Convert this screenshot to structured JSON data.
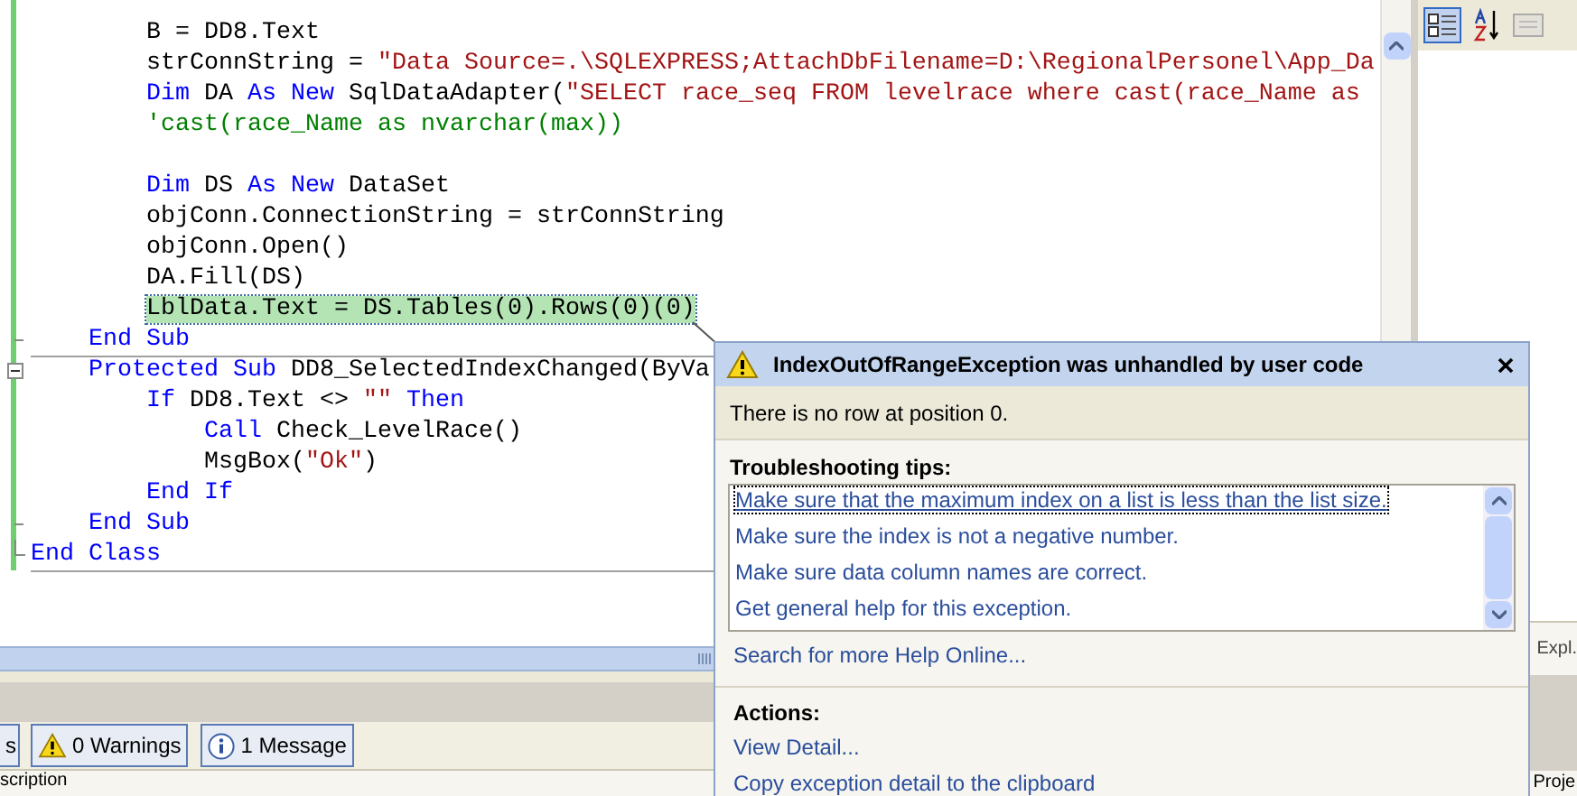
{
  "code_lines": [
    {
      "segments": [
        {
          "kind": "plain",
          "text": "        B = DD8.Text"
        }
      ]
    },
    {
      "segments": [
        {
          "kind": "plain",
          "text": "        strConnString = "
        },
        {
          "kind": "string",
          "text": "\"Data Source=.\\SQLEXPRESS;AttachDbFilename=D:\\RegionalPersonel\\App_Da"
        }
      ]
    },
    {
      "segments": [
        {
          "kind": "keyword",
          "text": "        Dim"
        },
        {
          "kind": "plain",
          "text": " DA "
        },
        {
          "kind": "keyword",
          "text": "As"
        },
        {
          "kind": "keyword",
          "text": " New"
        },
        {
          "kind": "plain",
          "text": " SqlDataAdapter("
        },
        {
          "kind": "string",
          "text": "\"SELECT race_seq FROM levelrace where cast(race_Name as"
        }
      ]
    },
    {
      "segments": [
        {
          "kind": "comment",
          "text": "        'cast(race_Name as nvarchar(max))"
        }
      ]
    },
    {
      "blank_line_before": true,
      "segments": [
        {
          "kind": "keyword",
          "text": "        Dim"
        },
        {
          "kind": "plain",
          "text": " DS "
        },
        {
          "kind": "keyword",
          "text": "As"
        },
        {
          "kind": "keyword",
          "text": " New"
        },
        {
          "kind": "plain",
          "text": " DataSet"
        }
      ]
    },
    {
      "segments": [
        {
          "kind": "plain",
          "text": "        objConn.ConnectionString = strConnString"
        }
      ]
    },
    {
      "segments": [
        {
          "kind": "plain",
          "text": "        objConn.Open()"
        }
      ]
    },
    {
      "segments": [
        {
          "kind": "plain",
          "text": "        DA.Fill(DS)"
        }
      ]
    },
    {
      "highlighted": true,
      "segments": [
        {
          "kind": "plain",
          "text": "        LblData.Text = DS.Tables(0).Rows(0)(0)"
        }
      ]
    },
    {
      "separator_below": true,
      "block_end": true,
      "segments": [
        {
          "kind": "keyword",
          "text": "    End Sub"
        }
      ]
    },
    {
      "expanded": true,
      "segments": [
        {
          "kind": "keyword",
          "text": "    Protected Sub"
        },
        {
          "kind": "plain",
          "text": " DD8_SelectedIndexChanged(ByVa"
        }
      ]
    },
    {
      "segments": [
        {
          "kind": "keyword",
          "text": "        If"
        },
        {
          "kind": "plain",
          "text": " DD8.Text <> "
        },
        {
          "kind": "string",
          "text": "\"\""
        },
        {
          "kind": "keyword",
          "text": " Then"
        }
      ]
    },
    {
      "segments": [
        {
          "kind": "keyword",
          "text": "            Call"
        },
        {
          "kind": "plain",
          "text": " Check_LevelRace()"
        }
      ]
    },
    {
      "segments": [
        {
          "kind": "plain",
          "text": "            MsgBox("
        },
        {
          "kind": "string",
          "text": "\"Ok\""
        },
        {
          "kind": "plain",
          "text": ")"
        }
      ]
    },
    {
      "segments": [
        {
          "kind": "keyword",
          "text": "        End If"
        }
      ]
    },
    {
      "block_end": true,
      "segments": [
        {
          "kind": "keyword",
          "text": "    End Sub"
        }
      ]
    },
    {
      "separator_below": true,
      "block_end": true,
      "segments": [
        {
          "kind": "keyword",
          "text": "End Class"
        }
      ]
    }
  ],
  "exception_helper": {
    "title": "IndexOutOfRangeException was unhandled by user code",
    "message": "There is no row at position 0.",
    "tips_heading": "Troubleshooting tips:",
    "tips": [
      {
        "text": "Make sure that the maximum index on a list is less than the list size.",
        "selected": true
      },
      {
        "text": "Make sure the index is not a negative number.",
        "selected": false
      },
      {
        "text": "Make sure data column names are correct.",
        "selected": false
      },
      {
        "text": "Get general help for this exception.",
        "selected": false
      }
    ],
    "search_link": "Search for more Help Online...",
    "actions_heading": "Actions:",
    "actions": [
      "View Detail...",
      "Copy exception detail to the clipboard"
    ]
  },
  "error_list": {
    "filters": [
      {
        "kind": "errors",
        "label": "s"
      },
      {
        "kind": "warnings",
        "label": "0 Warnings"
      },
      {
        "kind": "messages",
        "label": "1 Message"
      }
    ],
    "column_header": "scription"
  },
  "side_panel": {
    "tab": "Expl.",
    "column_header": "Proje"
  }
}
